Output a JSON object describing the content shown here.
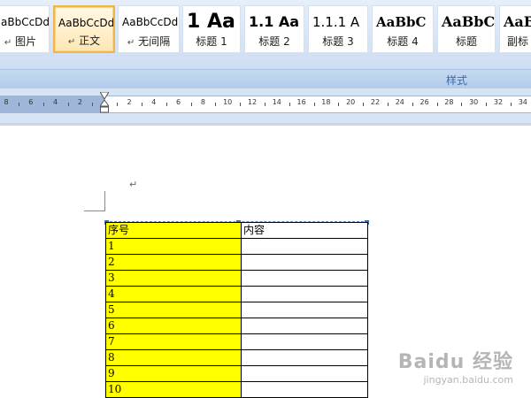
{
  "ribbon": {
    "styles": [
      {
        "preview": "aBbCcDd",
        "label": "图片",
        "mark": "↵",
        "selected": false
      },
      {
        "preview": "AaBbCcDd",
        "label": "正文",
        "mark": "↵",
        "selected": true
      },
      {
        "preview": "AaBbCcDd",
        "label": "无间隔",
        "mark": "↵",
        "selected": false
      },
      {
        "preview": "1  Aa",
        "label": "标题 1",
        "mark": "",
        "selected": false
      },
      {
        "preview": "1.1  Aa",
        "label": "标题 2",
        "mark": "",
        "selected": false
      },
      {
        "preview": "1.1.1  A",
        "label": "标题 3",
        "mark": "",
        "selected": false
      },
      {
        "preview": "AaBbC",
        "label": "标题 4",
        "mark": "",
        "selected": false
      },
      {
        "preview": "AaBbC",
        "label": "标题",
        "mark": "",
        "selected": false
      },
      {
        "preview": "AaB",
        "label": "副标",
        "mark": "",
        "selected": false
      }
    ],
    "group_label": "样式"
  },
  "ruler": {
    "ticks": [
      "8",
      "6",
      "4",
      "2",
      "",
      "2",
      "4",
      "6",
      "8",
      "10",
      "12",
      "14",
      "16",
      "18",
      "20",
      "22",
      "24",
      "26",
      "28",
      "30",
      "32",
      "34"
    ]
  },
  "document": {
    "paragraph_mark": "↵",
    "table": {
      "header": [
        "序号",
        "内容"
      ],
      "rows": [
        "1",
        "2",
        "3",
        "4",
        "5",
        "6",
        "7",
        "8",
        "9",
        "10"
      ]
    }
  },
  "watermark": {
    "brand": "Baidu 经验",
    "url": "jingyan.baidu.com"
  },
  "colors": {
    "highlight": "#ffff00",
    "selected_style_border": "#f1b449",
    "group_label": "#3e6aa6"
  }
}
